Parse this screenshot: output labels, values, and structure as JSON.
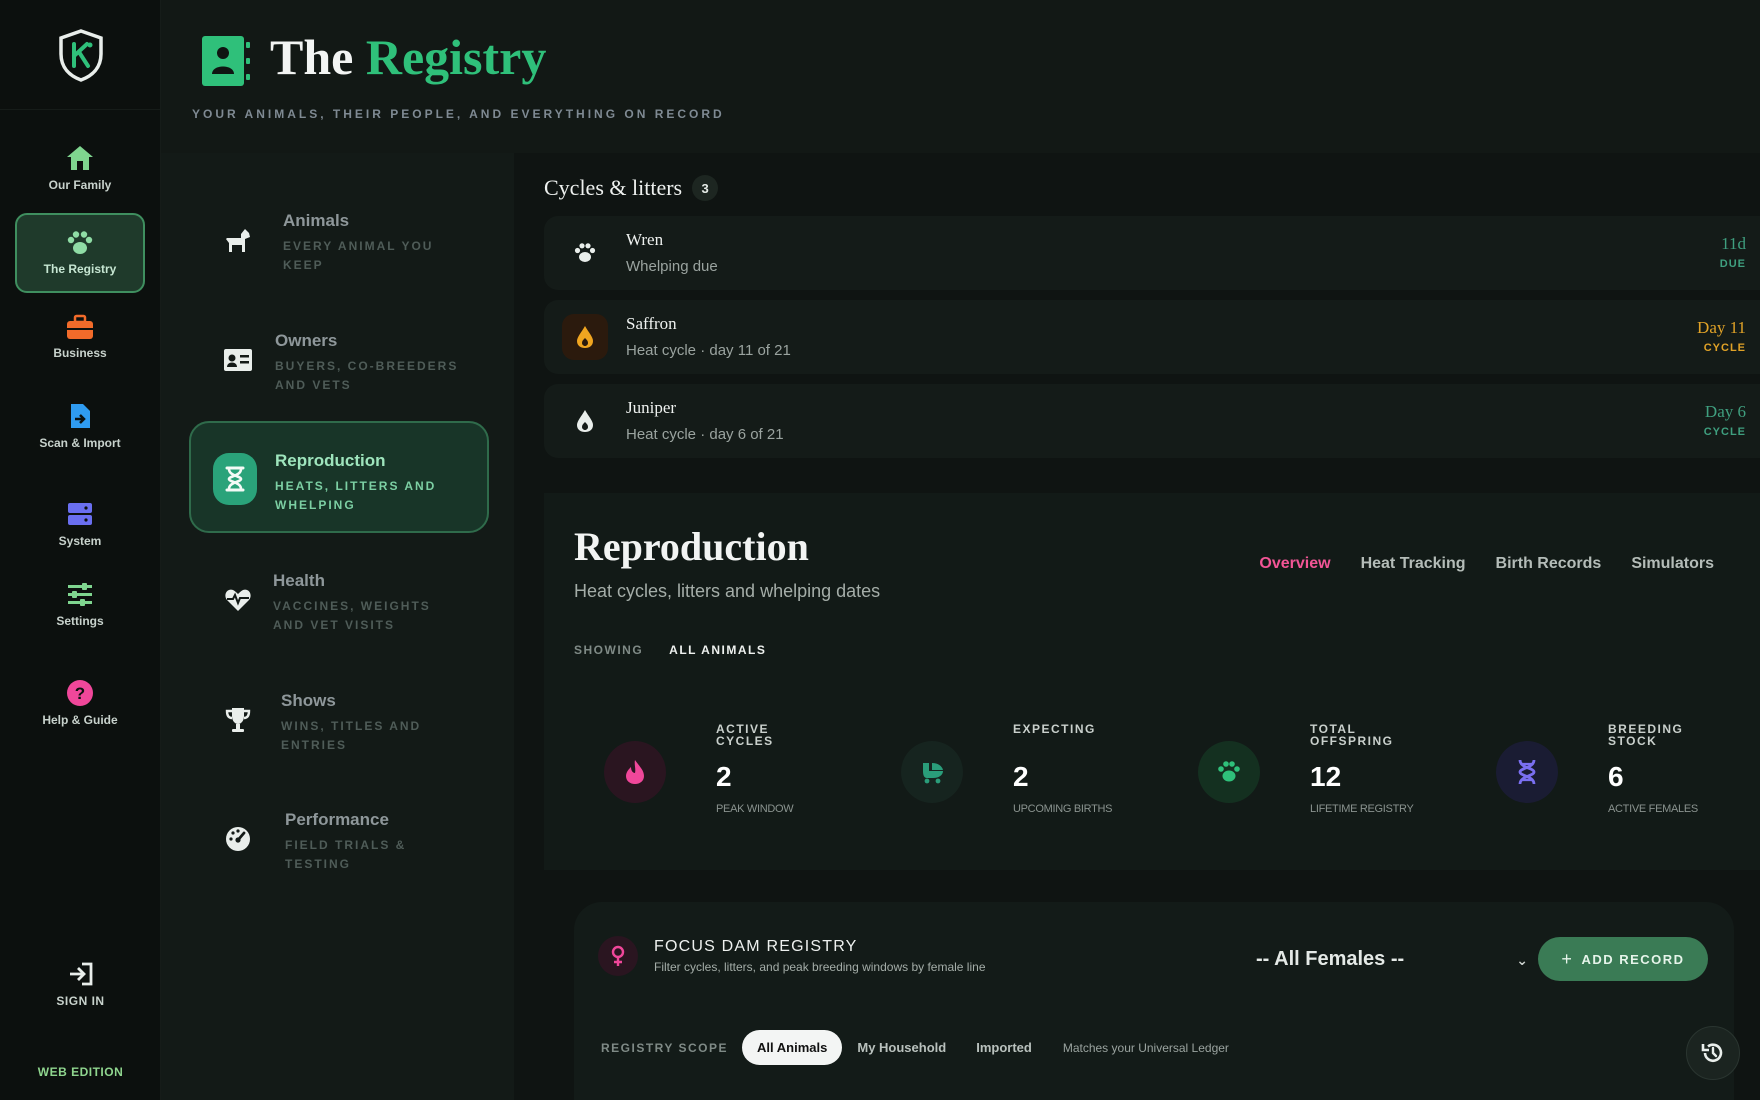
{
  "rail": {
    "items": [
      {
        "label": "Our Family"
      },
      {
        "label": "The Registry"
      },
      {
        "label": "Business"
      },
      {
        "label": "Scan & Import"
      },
      {
        "label": "System"
      },
      {
        "label": "Settings"
      },
      {
        "label": "Help & Guide"
      }
    ],
    "sign_in": "SIGN IN",
    "edition": "WEB EDITION"
  },
  "header": {
    "title_a": "The",
    "title_b": "Registry",
    "subtitle": "YOUR ANIMALS, THEIR PEOPLE, AND EVERYTHING ON RECORD"
  },
  "categories": [
    {
      "title": "Animals",
      "sub": "EVERY ANIMAL YOU KEEP"
    },
    {
      "title": "Owners",
      "sub": "BUYERS, CO-BREEDERS AND VETS"
    },
    {
      "title": "Reproduction",
      "sub": "HEATS, LITTERS AND WHELPING"
    },
    {
      "title": "Health",
      "sub": "VACCINES, WEIGHTS AND VET VISITS"
    },
    {
      "title": "Shows",
      "sub": "WINS, TITLES AND ENTRIES"
    },
    {
      "title": "Performance",
      "sub": "FIELD TRIALS & TESTING"
    }
  ],
  "cycles": {
    "title": "Cycles & litters",
    "count": "3",
    "rows": [
      {
        "name": "Wren",
        "desc": "Whelping due",
        "tag_value": "11d",
        "tag_label": "DUE",
        "color": "#3f9f7f"
      },
      {
        "name": "Saffron",
        "desc": "Heat cycle · day 11 of 21",
        "tag_value": "Day 11",
        "tag_label": "CYCLE",
        "color": "#e0a227"
      },
      {
        "name": "Juniper",
        "desc": "Heat cycle · day 6 of 21",
        "tag_value": "Day 6",
        "tag_label": "CYCLE",
        "color": "#3f9f7f"
      }
    ]
  },
  "reproduction": {
    "title": "Reproduction",
    "subtitle": "Heat cycles, litters and whelping dates",
    "tabs": [
      "Overview",
      "Heat Tracking",
      "Birth Records",
      "Simulators"
    ],
    "showing_label": "SHOWING",
    "showing_value": "ALL ANIMALS",
    "stats": [
      {
        "label": "ACTIVE CYCLES",
        "value": "2",
        "caption": "PEAK WINDOW"
      },
      {
        "label": "EXPECTING",
        "value": "2",
        "caption": "UPCOMING BIRTHS"
      },
      {
        "label": "TOTAL OFFSPRING",
        "value": "12",
        "caption": "LIFETIME REGISTRY"
      },
      {
        "label": "BREEDING STOCK",
        "value": "6",
        "caption": "ACTIVE FEMALES"
      }
    ]
  },
  "focus": {
    "title": "FOCUS DAM REGISTRY",
    "subtitle": "Filter cycles, litters, and peak breeding windows by female line",
    "select_value": "-- All Females --",
    "add_label": "ADD RECORD",
    "scope_label": "REGISTRY SCOPE",
    "scope_options": [
      "All Animals",
      "My Household",
      "Imported"
    ],
    "scope_note": "Matches your Universal Ledger"
  },
  "colors": {
    "accent": "#2fc07a",
    "pink": "#f25596",
    "active_border": "#3f8f5f"
  }
}
